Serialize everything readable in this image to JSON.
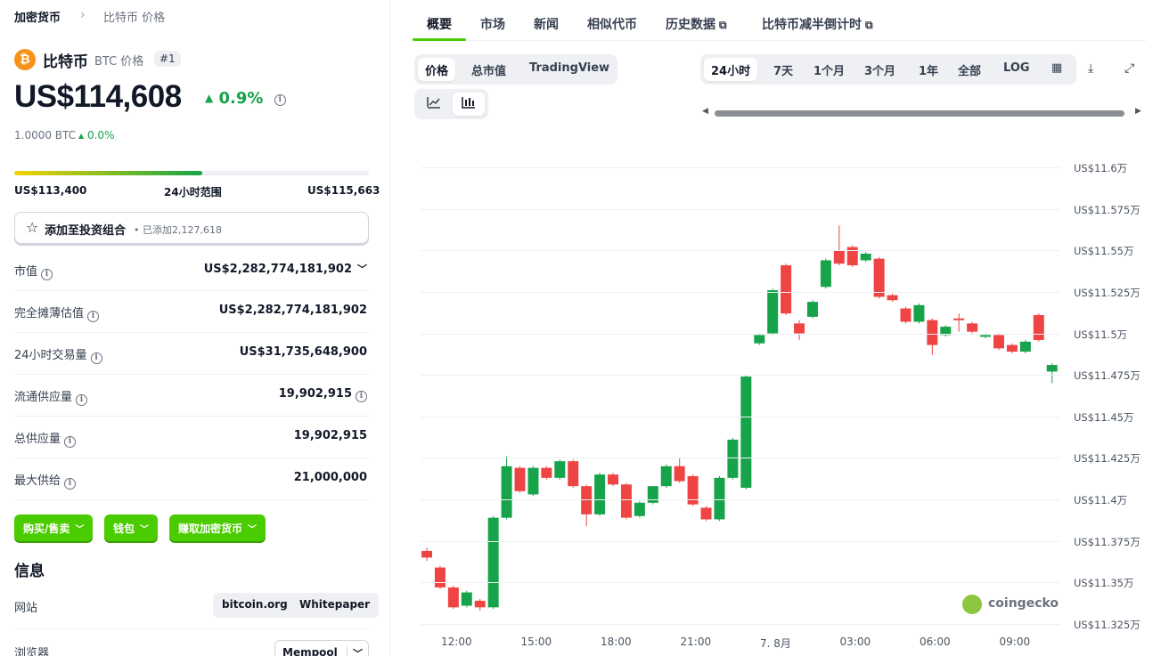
{
  "breadcrumb": {
    "root": "加密货币",
    "separator": "›",
    "current": "比特币 价格"
  },
  "coin": {
    "logo_glyph": "₿",
    "name": "比特币",
    "symbol_label": "BTC 价格",
    "rank": "#1",
    "price": "US$114,608",
    "change_24h": "0.9%",
    "btc_price": "1.0000 BTC",
    "btc_change": "0.0%",
    "accent_color": "#f7931a"
  },
  "range": {
    "low": "US$113,400",
    "label": "24小时范围",
    "high": "US$115,663",
    "position_fraction": 0.53
  },
  "portfolio": {
    "label": "添加至投资组合",
    "count": "• 已添加2,127,618"
  },
  "stats": [
    {
      "label": "市值",
      "value": "US$2,282,774,181,902"
    },
    {
      "label": "完全摊薄估值",
      "value": "US$2,282,774,181,902"
    },
    {
      "label": "24小时交易量",
      "value": "US$31,735,648,900"
    },
    {
      "label": "流通供应量",
      "value": "19,902,915"
    },
    {
      "label": "总供应量",
      "value": "19,902,915"
    },
    {
      "label": "最大供给",
      "value": "21,000,000"
    }
  ],
  "actions": {
    "buy_sell": "购买/售卖",
    "wallet": "钱包",
    "earn": "赚取加密货币"
  },
  "info": {
    "title": "信息",
    "website_label": "网站",
    "website_links": [
      "bitcoin.org",
      "Whitepaper"
    ],
    "explorer_label": "浏览器",
    "explorer_value": "Mempool"
  },
  "tabs": [
    "概要",
    "市场",
    "新闻",
    "相似代币",
    "历史数据",
    "比特币减半倒计时"
  ],
  "chart_controls": {
    "modes": [
      "价格",
      "总市值",
      "TradingView"
    ],
    "ranges": [
      "24小时",
      "7天",
      "1个月",
      "3个月",
      "1年",
      "全部",
      "LOG"
    ],
    "icons": [
      "calendar-icon",
      "download-icon",
      "expand-icon",
      "line-chart-icon",
      "candlestick-chart-icon"
    ]
  },
  "chart_data": {
    "type": "candlestick",
    "title": "",
    "xlabel": "",
    "ylabel": "",
    "ylim": [
      113250,
      116100
    ],
    "y_ticks": [
      "US$11.6万",
      "US$11.575万",
      "US$11.55万",
      "US$11.525万",
      "US$11.5万",
      "US$11.475万",
      "US$11.45万",
      "US$11.425万",
      "US$11.4万",
      "US$11.375万",
      "US$11.35万",
      "US$11.325万"
    ],
    "y_tick_values": [
      116000,
      115750,
      115500,
      115250,
      115000,
      114750,
      114500,
      114250,
      114000,
      113750,
      113500,
      113250
    ],
    "x_ticks": [
      "12:00",
      "15:00",
      "18:00",
      "21:00",
      "7. 8月",
      "03:00",
      "06:00",
      "09:00"
    ],
    "up_color": "#16a34a",
    "down_color": "#ef4444",
    "candles": [
      [
        113690,
        113650,
        113710,
        113630
      ],
      [
        113590,
        113470,
        113600,
        113460
      ],
      [
        113470,
        113350,
        113480,
        113340
      ],
      [
        113360,
        113440,
        113450,
        113350
      ],
      [
        113390,
        113350,
        113400,
        113330
      ],
      [
        113350,
        113890,
        113900,
        113340
      ],
      [
        113890,
        114200,
        114260,
        113880
      ],
      [
        114190,
        114050,
        114200,
        114040
      ],
      [
        114030,
        114190,
        114200,
        114020
      ],
      [
        114190,
        114130,
        114200,
        114120
      ],
      [
        114130,
        114230,
        114240,
        114120
      ],
      [
        114230,
        114080,
        114240,
        114070
      ],
      [
        114080,
        113910,
        114090,
        113840
      ],
      [
        113910,
        114150,
        114160,
        113900
      ],
      [
        114150,
        114090,
        114160,
        114080
      ],
      [
        114090,
        113890,
        114100,
        113880
      ],
      [
        113900,
        113980,
        113990,
        113890
      ],
      [
        113980,
        114080,
        114080,
        113970
      ],
      [
        114080,
        114200,
        114210,
        114070
      ],
      [
        114200,
        114110,
        114250,
        114100
      ],
      [
        114140,
        113970,
        114150,
        113960
      ],
      [
        113950,
        113880,
        113960,
        113870
      ],
      [
        113880,
        114130,
        114140,
        113870
      ],
      [
        114130,
        114360,
        114370,
        114120
      ],
      [
        114070,
        114740,
        114750,
        114060
      ],
      [
        114940,
        114990,
        115000,
        114930
      ],
      [
        115000,
        115260,
        115270,
        114990
      ],
      [
        115410,
        115120,
        115420,
        115110
      ],
      [
        115060,
        115000,
        115080,
        114960
      ],
      [
        115100,
        115190,
        115200,
        115090
      ],
      [
        115280,
        115440,
        115450,
        115270
      ],
      [
        115500,
        115420,
        115650,
        115410
      ],
      [
        115520,
        115410,
        115530,
        115400
      ],
      [
        115440,
        115480,
        115490,
        115430
      ],
      [
        115450,
        115220,
        115460,
        115210
      ],
      [
        115230,
        115200,
        115240,
        115190
      ],
      [
        115150,
        115070,
        115160,
        115060
      ],
      [
        115070,
        115170,
        115180,
        115060
      ],
      [
        115080,
        114930,
        115090,
        114870
      ],
      [
        114990,
        115040,
        115050,
        114980
      ],
      [
        115090,
        115080,
        115120,
        115010
      ],
      [
        115060,
        115010,
        115070,
        115000
      ],
      [
        114980,
        114990,
        115000,
        114970
      ],
      [
        114990,
        114910,
        115000,
        114900
      ],
      [
        114930,
        114890,
        114940,
        114880
      ],
      [
        114890,
        114950,
        114960,
        114880
      ],
      [
        115110,
        114960,
        115120,
        114950
      ],
      [
        114770,
        114810,
        114820,
        114700
      ]
    ]
  },
  "watermark": "coingecko"
}
